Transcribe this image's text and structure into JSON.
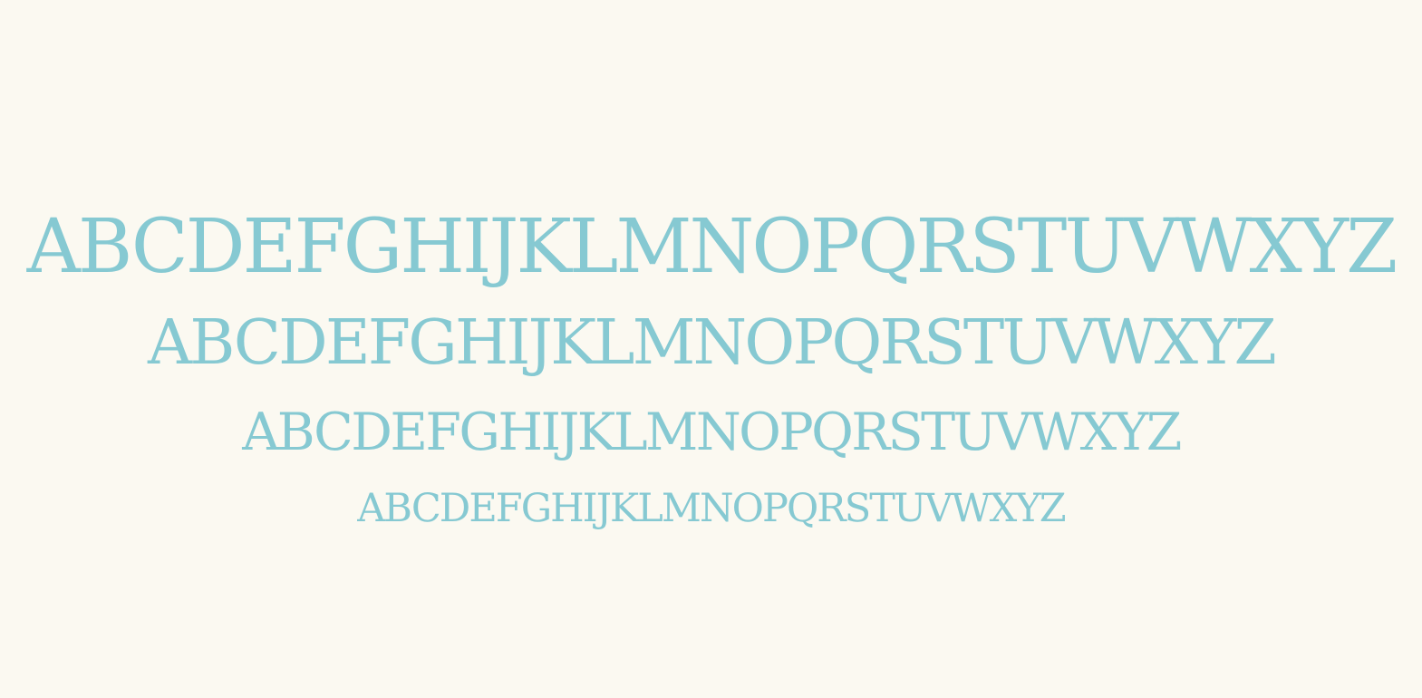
{
  "colors": {
    "background": "#fbf9f1",
    "text": "#86c9d2"
  },
  "specimen": {
    "lines": [
      "ABCDEFGHIJKLMNOPQRSTUVWXYZ",
      "ABCDEFGHIJKLMNOPQRSTUVWXYZ",
      "ABCDEFGHIJKLMNOPQRSTUVWXYZ",
      "ABCDEFGHIJKLMNOPQRSTUVWXYZ"
    ]
  }
}
